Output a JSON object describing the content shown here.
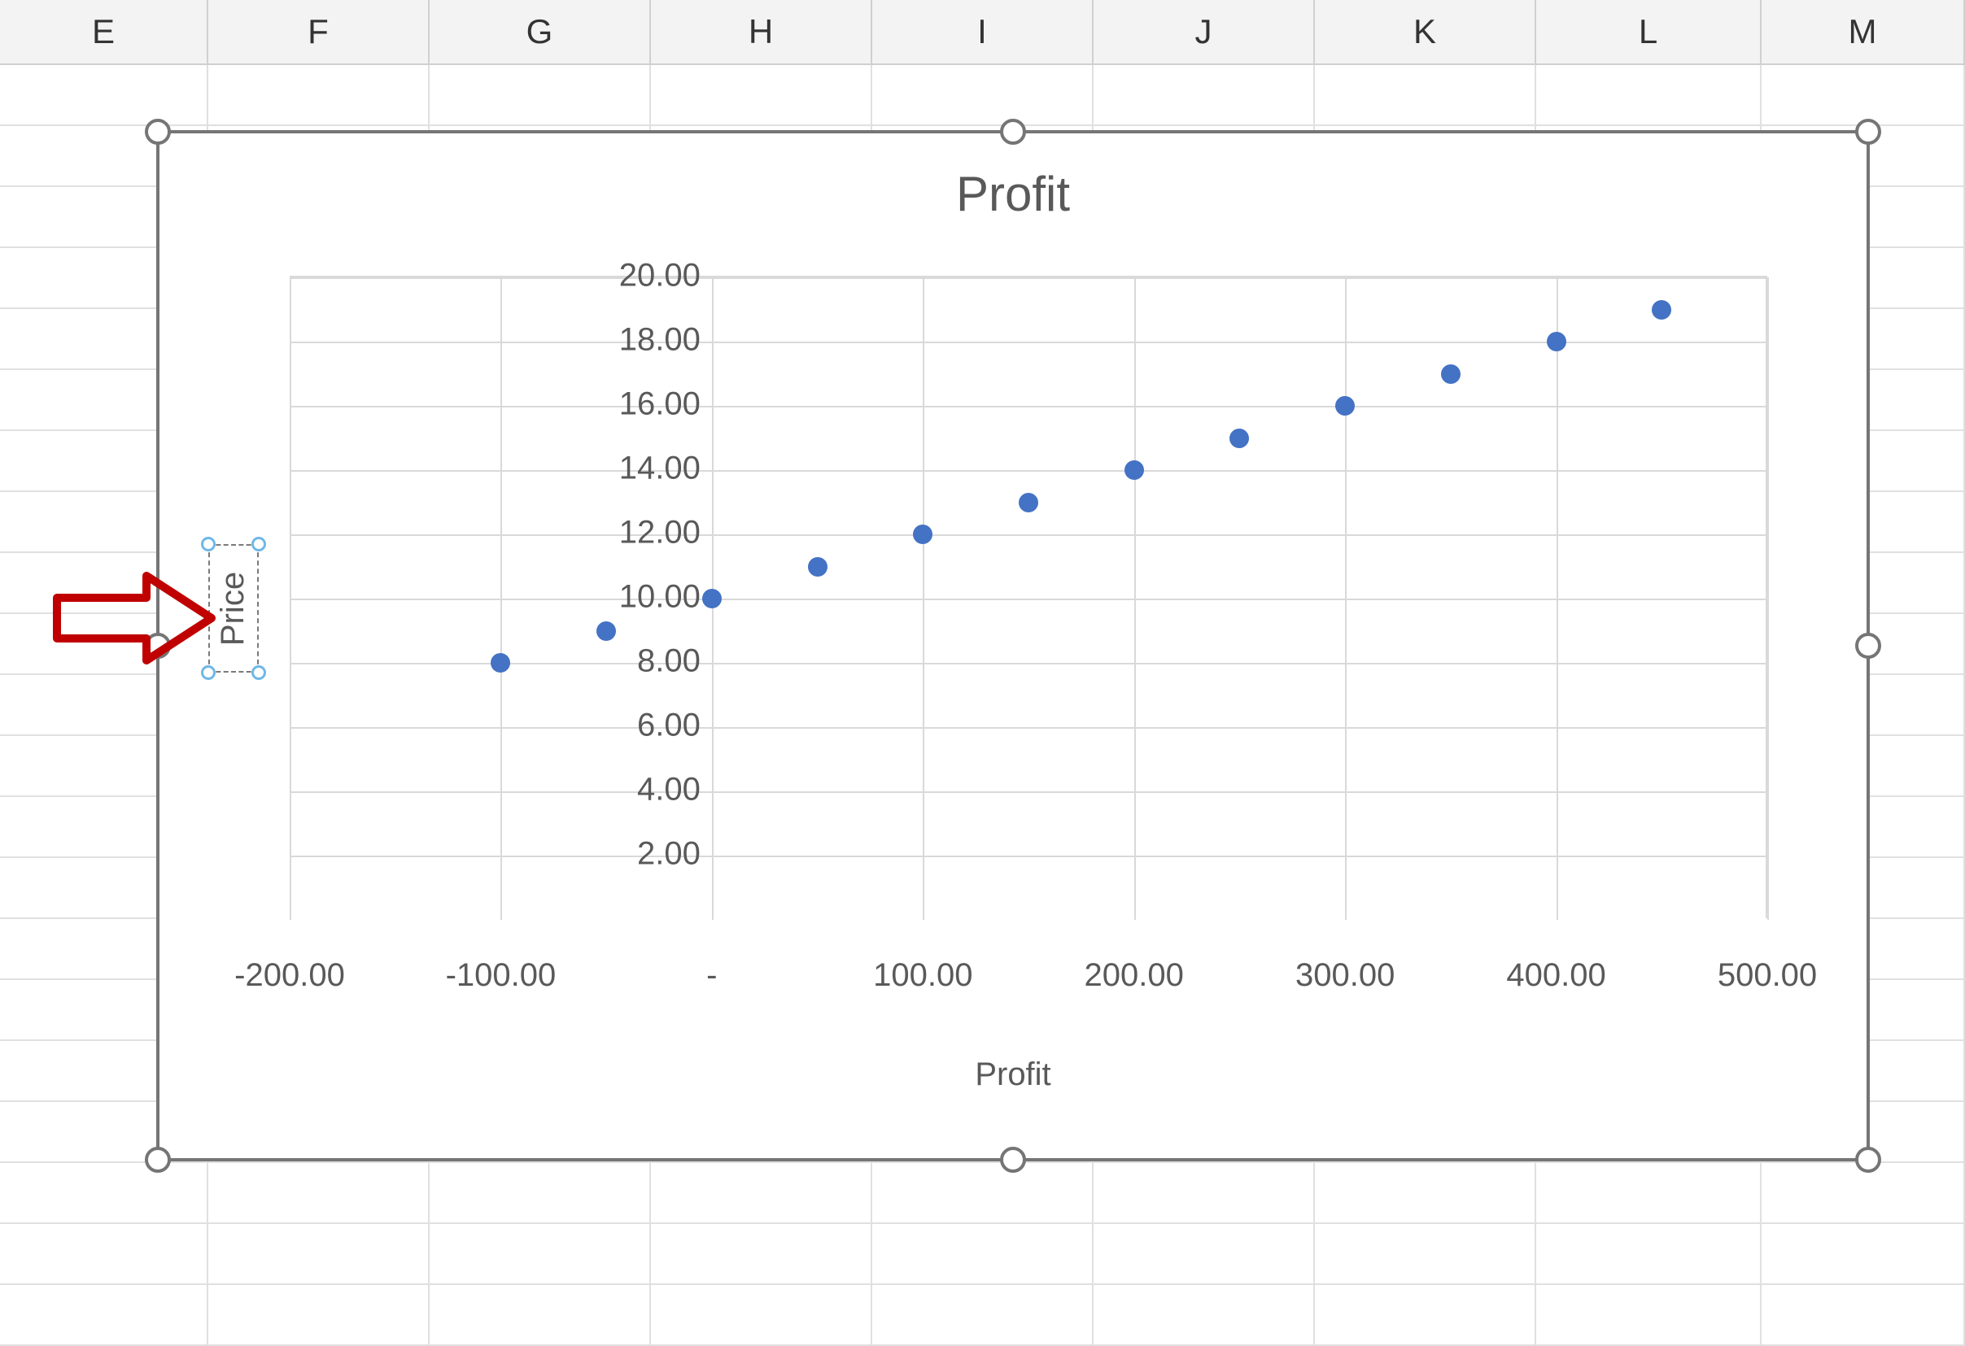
{
  "columns": [
    "E",
    "F",
    "G",
    "H",
    "I",
    "J",
    "K",
    "L",
    "M"
  ],
  "chart": {
    "title": "Profit",
    "xaxis_title": "Profit",
    "yaxis_title": "Price",
    "y_ticks": [
      "20.00",
      "18.00",
      "16.00",
      "14.00",
      "12.00",
      "10.00",
      "8.00",
      "6.00",
      "4.00",
      "2.00"
    ],
    "x_ticks": [
      "-200.00",
      "-100.00",
      "-",
      "100.00",
      "200.00",
      "300.00",
      "400.00",
      "500.00"
    ]
  },
  "colors": {
    "point": "#4472C4",
    "grid": "#d9d9d9",
    "text": "#595959",
    "selection": "#757575",
    "arrow": "#c00000",
    "label_handle": "#6fb7e8"
  },
  "chart_data": {
    "type": "scatter",
    "title": "Profit",
    "xlabel": "Profit",
    "ylabel": "Price",
    "xlim": [
      -200,
      500
    ],
    "ylim": [
      0,
      20
    ],
    "x_ticks": [
      -200,
      -100,
      0,
      100,
      200,
      300,
      400,
      500
    ],
    "y_ticks": [
      2,
      4,
      6,
      8,
      10,
      12,
      14,
      16,
      18,
      20
    ],
    "series": [
      {
        "name": "Profit",
        "points": [
          {
            "x": -100,
            "y": 8
          },
          {
            "x": -50,
            "y": 9
          },
          {
            "x": 0,
            "y": 10
          },
          {
            "x": 50,
            "y": 11
          },
          {
            "x": 100,
            "y": 12
          },
          {
            "x": 150,
            "y": 13
          },
          {
            "x": 200,
            "y": 14
          },
          {
            "x": 250,
            "y": 15
          },
          {
            "x": 300,
            "y": 16
          },
          {
            "x": 350,
            "y": 17
          },
          {
            "x": 400,
            "y": 18
          },
          {
            "x": 450,
            "y": 19
          }
        ]
      }
    ]
  }
}
